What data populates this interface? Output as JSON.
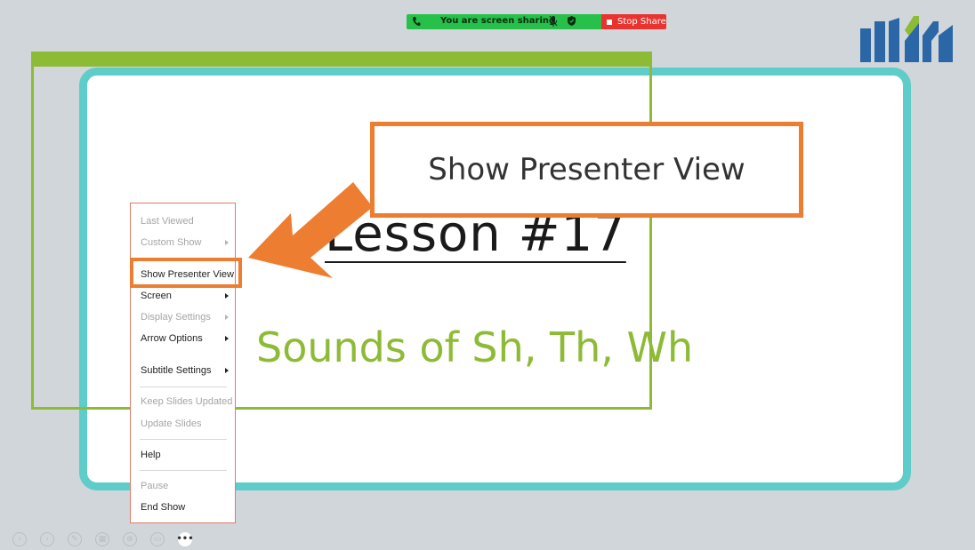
{
  "share_bar": {
    "status_text": "You are screen sharing",
    "stop_label": "Stop Share",
    "green": "#26c04a",
    "red": "#e8332f"
  },
  "slide": {
    "title": "Lesson #17",
    "subtitle": "Sounds of Sh, Th, Wh",
    "border_color": "#5ecdc9",
    "subtitle_color": "#8dbb35"
  },
  "callout": {
    "text": "Show Presenter View",
    "color": "#ed7d31"
  },
  "menu": {
    "items": [
      {
        "label": "Last Viewed",
        "disabled": true,
        "submenu": false
      },
      {
        "label": "Custom Show",
        "disabled": true,
        "submenu": true
      },
      {
        "label": "Show Presenter View",
        "disabled": false,
        "submenu": false,
        "highlighted": true
      },
      {
        "label": "Screen",
        "disabled": false,
        "submenu": true
      },
      {
        "label": "Display Settings",
        "disabled": true,
        "submenu": true
      },
      {
        "label": "Arrow Options",
        "disabled": false,
        "submenu": true
      },
      {
        "label": "Subtitle Settings",
        "disabled": false,
        "submenu": true
      },
      {
        "label": "Keep Slides Updated",
        "disabled": true,
        "submenu": false
      },
      {
        "label": "Update Slides",
        "disabled": true,
        "submenu": false
      },
      {
        "label": "Help",
        "disabled": false,
        "submenu": false
      },
      {
        "label": "Pause",
        "disabled": true,
        "submenu": false
      },
      {
        "label": "End Show",
        "disabled": false,
        "submenu": false
      }
    ]
  },
  "toolbar": {
    "icons": [
      "previous-icon",
      "next-icon",
      "pen-icon",
      "slides-grid-icon",
      "zoom-icon",
      "subtitles-icon",
      "more-options-icon"
    ],
    "more_label": "•••"
  }
}
